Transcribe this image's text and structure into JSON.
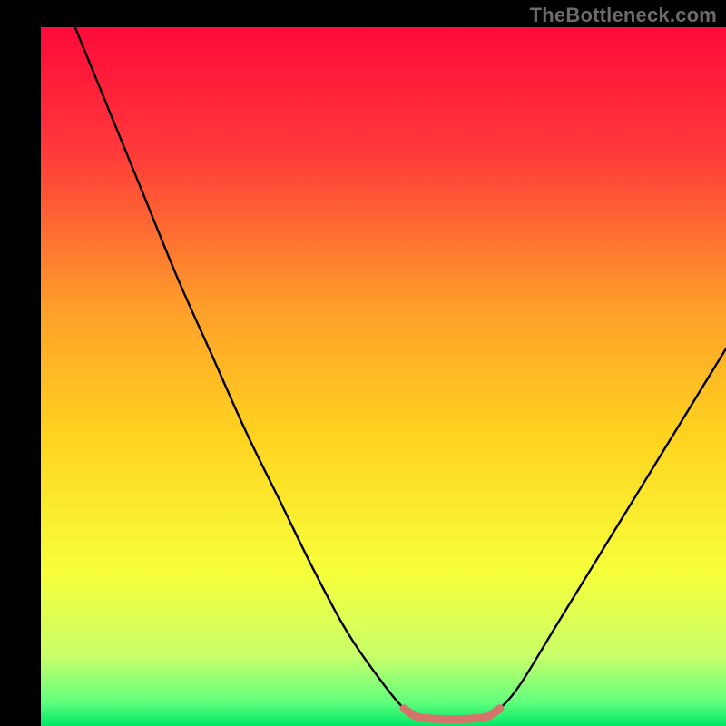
{
  "watermark": "TheBottleneck.com",
  "chart_data": {
    "type": "line",
    "title": "",
    "xlabel": "",
    "ylabel": "",
    "x_range": [
      0,
      100
    ],
    "y_range": [
      0,
      100
    ],
    "background_gradient": {
      "stops": [
        {
          "pos": 0.0,
          "color": "#ff0a3a"
        },
        {
          "pos": 0.18,
          "color": "#ff3a3a"
        },
        {
          "pos": 0.4,
          "color": "#ff9e2a"
        },
        {
          "pos": 0.58,
          "color": "#ffd21f"
        },
        {
          "pos": 0.78,
          "color": "#f7ff3a"
        },
        {
          "pos": 0.9,
          "color": "#c8ff6a"
        },
        {
          "pos": 0.965,
          "color": "#63ff7e"
        },
        {
          "pos": 1.0,
          "color": "#00e765"
        }
      ]
    },
    "series": [
      {
        "name": "bottleneck-curve",
        "color": "#000000",
        "stroke_width": 2.4,
        "points": [
          {
            "x": 5,
            "y": 100
          },
          {
            "x": 10,
            "y": 88
          },
          {
            "x": 15,
            "y": 76
          },
          {
            "x": 20,
            "y": 64
          },
          {
            "x": 25,
            "y": 53
          },
          {
            "x": 30,
            "y": 42
          },
          {
            "x": 35,
            "y": 32
          },
          {
            "x": 40,
            "y": 22
          },
          {
            "x": 45,
            "y": 13
          },
          {
            "x": 50,
            "y": 6
          },
          {
            "x": 53,
            "y": 2.5
          },
          {
            "x": 55,
            "y": 1.3
          },
          {
            "x": 58,
            "y": 1.0
          },
          {
            "x": 62,
            "y": 1.0
          },
          {
            "x": 65,
            "y": 1.3
          },
          {
            "x": 67,
            "y": 2.5
          },
          {
            "x": 70,
            "y": 6
          },
          {
            "x": 75,
            "y": 14
          },
          {
            "x": 80,
            "y": 22
          },
          {
            "x": 85,
            "y": 30
          },
          {
            "x": 90,
            "y": 38
          },
          {
            "x": 95,
            "y": 46
          },
          {
            "x": 100,
            "y": 54
          }
        ]
      },
      {
        "name": "highlight-valley",
        "color": "#d6746c",
        "stroke_width": 9,
        "points": [
          {
            "x": 53,
            "y": 2.5
          },
          {
            "x": 55,
            "y": 1.3
          },
          {
            "x": 58,
            "y": 1.0
          },
          {
            "x": 62,
            "y": 1.0
          },
          {
            "x": 65,
            "y": 1.3
          },
          {
            "x": 67,
            "y": 2.5
          }
        ]
      }
    ]
  }
}
